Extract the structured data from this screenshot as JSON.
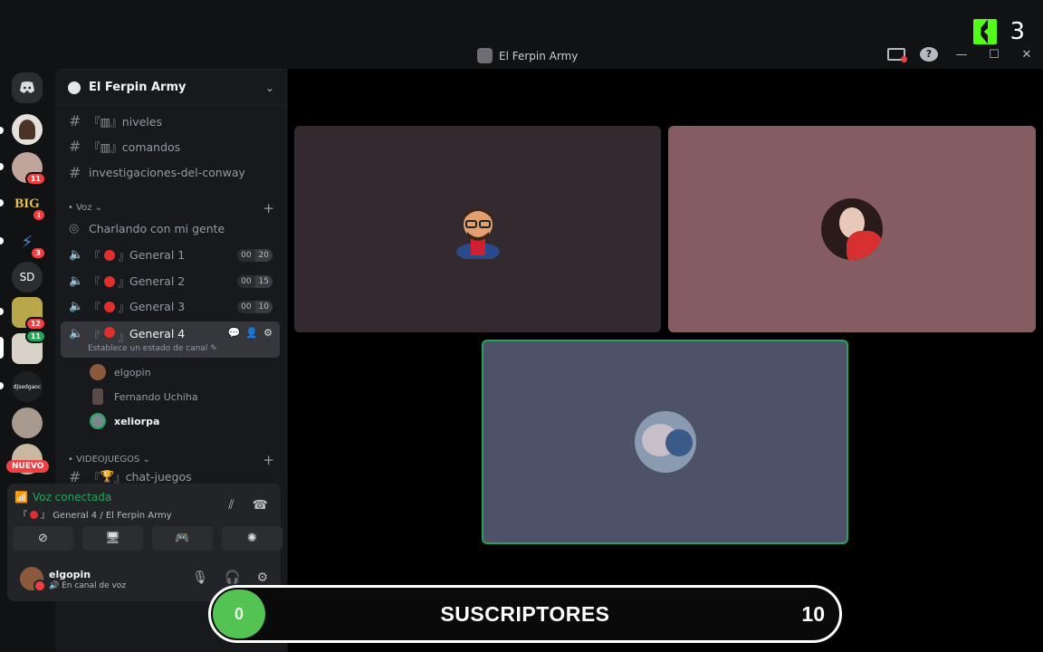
{
  "kick": {
    "count": "3"
  },
  "window": {
    "title": "El Ferpin Army"
  },
  "rail": {
    "servers": [
      {
        "name": "avatar-server",
        "badge": ""
      },
      {
        "name": "server-2",
        "badge": "11"
      },
      {
        "name": "big-server",
        "label": "BIG",
        "badge": "1"
      },
      {
        "name": "server-4",
        "badge": "3"
      },
      {
        "name": "sd-server",
        "label": "SD",
        "badge": ""
      },
      {
        "name": "server-6",
        "badge": "12"
      },
      {
        "name": "server-7",
        "badge": "11"
      },
      {
        "name": "server-8",
        "label": "djsedgaoc",
        "badge": ""
      },
      {
        "name": "server-9",
        "badge": ""
      },
      {
        "name": "server-10",
        "badge": ""
      }
    ],
    "nuevo_label": "NUEVO"
  },
  "sidebar": {
    "server_name": "El Ferpin Army",
    "text_channels": [
      {
        "name": "『▥』niveles"
      },
      {
        "name": "『▥』comandos"
      },
      {
        "name": "investigaciones-del-conway"
      }
    ],
    "voice_category": "Voz",
    "stage_channel": "Charlando con mi gente",
    "voice_channels": [
      {
        "name": "General 1",
        "count": "00",
        "limit": "20"
      },
      {
        "name": "General 2",
        "count": "00",
        "limit": "15"
      },
      {
        "name": "General 3",
        "count": "00",
        "limit": "10"
      }
    ],
    "active_channel": {
      "name": "General 4",
      "status_hint": "Establece un estado de canal"
    },
    "members": [
      {
        "name": "elgopin"
      },
      {
        "name": "Fernando Uchiha"
      },
      {
        "name": "xeliorpa"
      }
    ],
    "games_category": "VIDEOJUEGOS",
    "games_channel": "chat-juegos"
  },
  "voice_panel": {
    "status": "Voz conectada",
    "location": "General 4 / El Ferpin Army",
    "user_name": "elgopin",
    "user_status": "En canal de voz"
  },
  "overlay": {
    "current": "0",
    "label": "SUSCRIPTORES",
    "goal": "10",
    "progress_fraction": 0
  },
  "colors": {
    "kick_green": "#53fc18",
    "connected_green": "#23a55a",
    "tile1": "#322a2f",
    "tile2": "#845c62",
    "tile3": "#4d5268"
  }
}
